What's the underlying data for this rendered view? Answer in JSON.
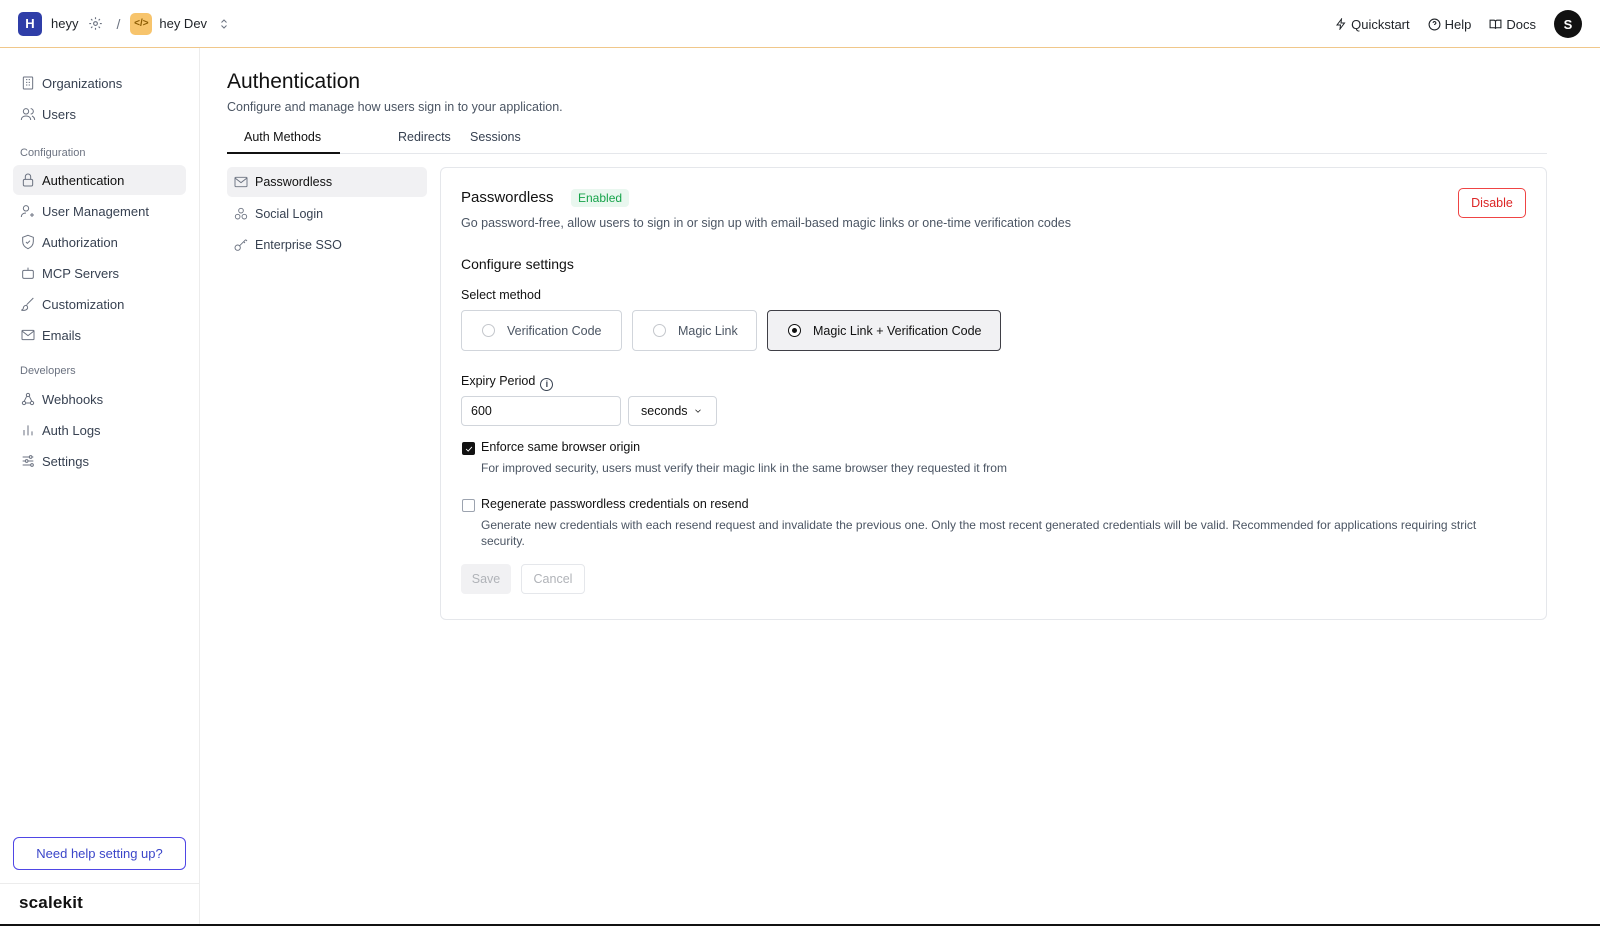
{
  "topbar": {
    "org_initial": "H",
    "org_name": "heyy",
    "separator": "/",
    "env_badge": "</>",
    "env_name": "hey Dev",
    "links": {
      "quickstart": "Quickstart",
      "help": "Help",
      "docs": "Docs"
    },
    "avatar_initial": "S"
  },
  "sidebar": {
    "items": [
      {
        "label": "Organizations",
        "icon": "building-icon"
      },
      {
        "label": "Users",
        "icon": "users-icon"
      }
    ],
    "config_section": "Configuration",
    "config_items": [
      {
        "label": "Authentication",
        "icon": "lock-icon",
        "active": true
      },
      {
        "label": "User Management",
        "icon": "user-cog-icon"
      },
      {
        "label": "Authorization",
        "icon": "shield-icon"
      },
      {
        "label": "MCP Servers",
        "icon": "robot-icon"
      },
      {
        "label": "Customization",
        "icon": "brush-icon"
      },
      {
        "label": "Emails",
        "icon": "mail-icon"
      }
    ],
    "dev_section": "Developers",
    "dev_items": [
      {
        "label": "Webhooks",
        "icon": "webhook-icon"
      },
      {
        "label": "Auth Logs",
        "icon": "bar-chart-icon"
      },
      {
        "label": "Settings",
        "icon": "sliders-icon"
      }
    ],
    "help_button": "Need help setting up?",
    "brand": "scalekit"
  },
  "main": {
    "title": "Authentication",
    "subtitle": "Configure and manage how users sign in to your application.",
    "tabs": [
      "Auth Methods",
      "Redirects",
      "Sessions"
    ],
    "active_tab": "Auth Methods",
    "subnav": [
      {
        "label": "Passwordless",
        "icon": "mail-icon",
        "active": true
      },
      {
        "label": "Social Login",
        "icon": "social-icon"
      },
      {
        "label": "Enterprise SSO",
        "icon": "key-icon"
      }
    ]
  },
  "card": {
    "title": "Passwordless",
    "status": "Enabled",
    "description": "Go password-free, allow users to sign in or sign up with email-based magic links or one-time verification codes",
    "disable_label": "Disable",
    "section_title": "Configure settings",
    "method_label": "Select method",
    "methods": [
      "Verification Code",
      "Magic Link",
      "Magic Link + Verification Code"
    ],
    "selected_method": "Magic Link + Verification Code",
    "expiry_label": "Expiry Period",
    "expiry_value": "600",
    "expiry_unit": "seconds",
    "enforce_title": "Enforce same browser origin",
    "enforce_desc": "For improved security, users must verify their magic link in the same browser they requested it from",
    "enforce_checked": true,
    "regen_title": "Regenerate passwordless credentials on resend",
    "regen_desc": "Generate new credentials with each resend request and invalidate the previous one. Only the most recent generated credentials will be valid. Recommended for applications requiring strict security.",
    "regen_checked": false,
    "save_label": "Save",
    "cancel_label": "Cancel"
  },
  "colors": {
    "accent": "#4f46e5",
    "topbar_border": "#f0c78a",
    "enabled_green": "#16a34a",
    "danger": "#dc2626"
  }
}
